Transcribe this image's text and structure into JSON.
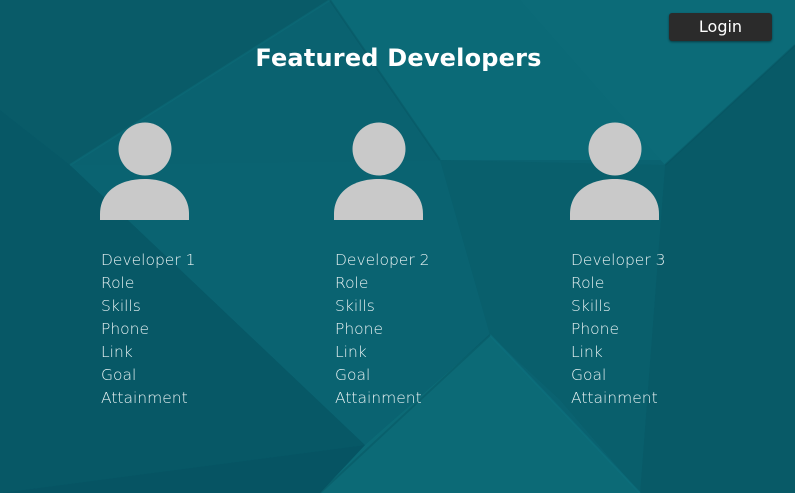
{
  "header": {
    "login_label": "Login"
  },
  "page": {
    "title": "Featured Developers"
  },
  "developers": [
    {
      "name": "Developer 1",
      "role": "Role",
      "skills": "Skills",
      "phone": "Phone",
      "link": "Link",
      "goal": "Goal",
      "attainment": "Attainment",
      "avatar_icon": "user-silhouette-icon"
    },
    {
      "name": "Developer 2",
      "role": "Role",
      "skills": "Skills",
      "phone": "Phone",
      "link": "Link",
      "goal": "Goal",
      "attainment": "Attainment",
      "avatar_icon": "user-silhouette-icon"
    },
    {
      "name": "Developer 3",
      "role": "Role",
      "skills": "Skills",
      "phone": "Phone",
      "link": "Link",
      "goal": "Goal",
      "attainment": "Attainment",
      "avatar_icon": "user-silhouette-icon"
    }
  ],
  "colors": {
    "background": "#0a6270",
    "avatar": "#c9c9c9",
    "login_button": "#2b2b2b",
    "text": "#ffffff"
  }
}
